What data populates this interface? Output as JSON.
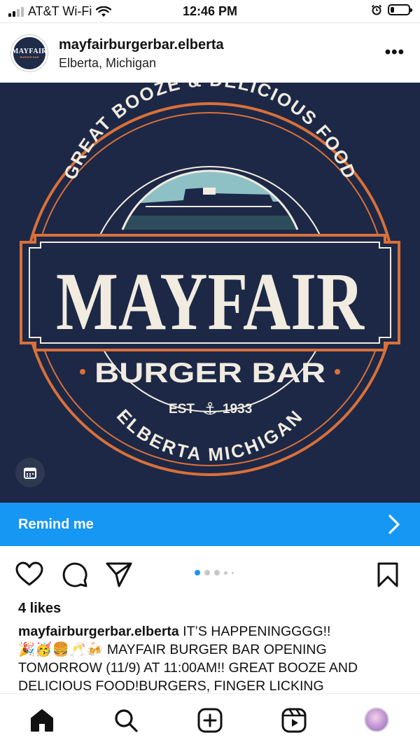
{
  "status_bar": {
    "carrier": "AT&T Wi-Fi",
    "time": "12:46 PM",
    "battery_level": 0.15
  },
  "post": {
    "username": "mayfairburgerbar.elberta",
    "location": "Elberta, Michigan",
    "avatar_text": "MAYFAIR",
    "avatar_subtext": "BURGER BAR",
    "more_label": "•••"
  },
  "image": {
    "arc_top": "GREAT BOOZE & DELICIOUS FOOD",
    "title": "MAYFAIR",
    "subtitle": "BURGER BAR",
    "est": "EST",
    "year": "1933",
    "arc_bottom": "ELBERTA MICHIGAN",
    "colors": {
      "background": "#1c2846",
      "orange": "#d9703a",
      "cream": "#f1ebe0",
      "sky": "#8ec1c6"
    }
  },
  "remind": {
    "label": "Remind me",
    "color": "#1597f3"
  },
  "actions": {
    "icons": [
      "heart-icon",
      "comment-icon",
      "share-icon",
      "bookmark-icon"
    ],
    "carousel_pages": 5,
    "carousel_active": 1
  },
  "likes": "4 likes",
  "caption": {
    "username": "mayfairburgerbar.elberta",
    "text_line1": " IT’S HAPPENINGGGG!!",
    "emojis": "🎉🥳🍔🥂🍻",
    "text_line2": " MAYFAIR BURGER BAR OPENING TOMORROW (11/9) AT 11:00AM!! GREAT BOOZE AND DELICIOUS FOOD!BURGERS, FINGER LICKING"
  },
  "bottom_nav": {
    "items": [
      "home-icon",
      "search-icon",
      "create-icon",
      "reels-icon",
      "profile-avatar"
    ]
  }
}
